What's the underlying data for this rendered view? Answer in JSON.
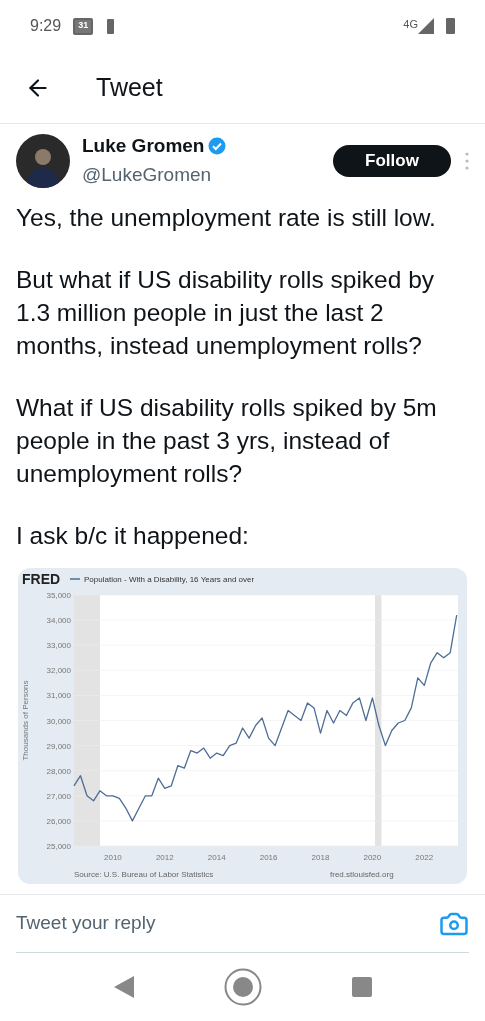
{
  "status_bar": {
    "time": "9:29",
    "calendar_day": "31",
    "network": "4G"
  },
  "header": {
    "title": "Tweet"
  },
  "tweet": {
    "author": {
      "name": "Luke Gromen",
      "handle": "@LukeGromen",
      "verified": true
    },
    "follow_button": "Follow",
    "paragraphs": [
      "Yes, the unemployment rate is still low.",
      "But what if US disability rolls spiked by 1.3 million people in just the last 2 months, instead unemployment rolls?",
      "What if US disability rolls spiked by 5m people in the past 3 yrs, instead of unemployment rolls?",
      "I ask b/c it happened:"
    ],
    "chart": {
      "logo": "FRED",
      "source": "Source: U.S. Bureau of Labor Statistics",
      "site": "fred.stlouisfed.org",
      "chart_data": {
        "type": "line",
        "grid": true,
        "bands": [
          {
            "axis": "x",
            "from": 2008.5,
            "to": 2009.5
          },
          {
            "axis": "x",
            "from": 2020.1,
            "to": 2020.35
          }
        ],
        "ylabel": "Thousands of Persons",
        "xlim": [
          2008.5,
          2023.3
        ],
        "ylim": [
          25000,
          35000
        ],
        "xticks": [
          2010,
          2012,
          2014,
          2016,
          2018,
          2020,
          2022
        ],
        "yticks": [
          {
            "value": 25000,
            "label": "25,000"
          },
          {
            "value": 26000,
            "label": "26,000"
          },
          {
            "value": 27000,
            "label": "27,000"
          },
          {
            "value": 28000,
            "label": "28,000"
          },
          {
            "value": 29000,
            "label": "29,000"
          },
          {
            "value": 30000,
            "label": "30,000"
          },
          {
            "value": 31000,
            "label": "31,000"
          },
          {
            "value": 32000,
            "label": "32,000"
          },
          {
            "value": 33000,
            "label": "33,000"
          },
          {
            "value": 34000,
            "label": "34,000"
          },
          {
            "value": 35000,
            "label": "35,000"
          }
        ],
        "x": [
          2008.5,
          2008.75,
          2009.0,
          2009.25,
          2009.5,
          2009.75,
          2010.0,
          2010.25,
          2010.5,
          2010.75,
          2011.0,
          2011.25,
          2011.5,
          2011.75,
          2012.0,
          2012.25,
          2012.5,
          2012.75,
          2013.0,
          2013.25,
          2013.5,
          2013.75,
          2014.0,
          2014.25,
          2014.5,
          2014.75,
          2015.0,
          2015.25,
          2015.5,
          2015.75,
          2016.0,
          2016.25,
          2016.5,
          2016.75,
          2017.0,
          2017.25,
          2017.5,
          2017.75,
          2018.0,
          2018.25,
          2018.5,
          2018.75,
          2019.0,
          2019.25,
          2019.5,
          2019.75,
          2020.0,
          2020.25,
          2020.5,
          2020.75,
          2021.0,
          2021.25,
          2021.5,
          2021.75,
          2022.0,
          2022.25,
          2022.5,
          2022.75,
          2023.0,
          2023.25
        ],
        "series": [
          {
            "name": "Population - With a Disability, 16 Years and over",
            "color": "#4e6d96",
            "values": [
              27400,
              27800,
              27000,
              26800,
              27200,
              27000,
              27000,
              26900,
              26500,
              26000,
              26500,
              27000,
              27000,
              27700,
              27300,
              27400,
              28200,
              28100,
              28800,
              28700,
              28900,
              28500,
              28700,
              28600,
              29000,
              29100,
              29700,
              29300,
              29800,
              30100,
              29300,
              29000,
              29700,
              30400,
              30200,
              30000,
              30700,
              30500,
              29500,
              30400,
              29900,
              30400,
              30200,
              30700,
              30900,
              30000,
              30900,
              29800,
              29000,
              29600,
              29900,
              30000,
              30500,
              31700,
              31400,
              32300,
              32700,
              32500,
              32700,
              34200
            ]
          }
        ]
      }
    }
  },
  "reply": {
    "placeholder": "Tweet your reply"
  }
}
